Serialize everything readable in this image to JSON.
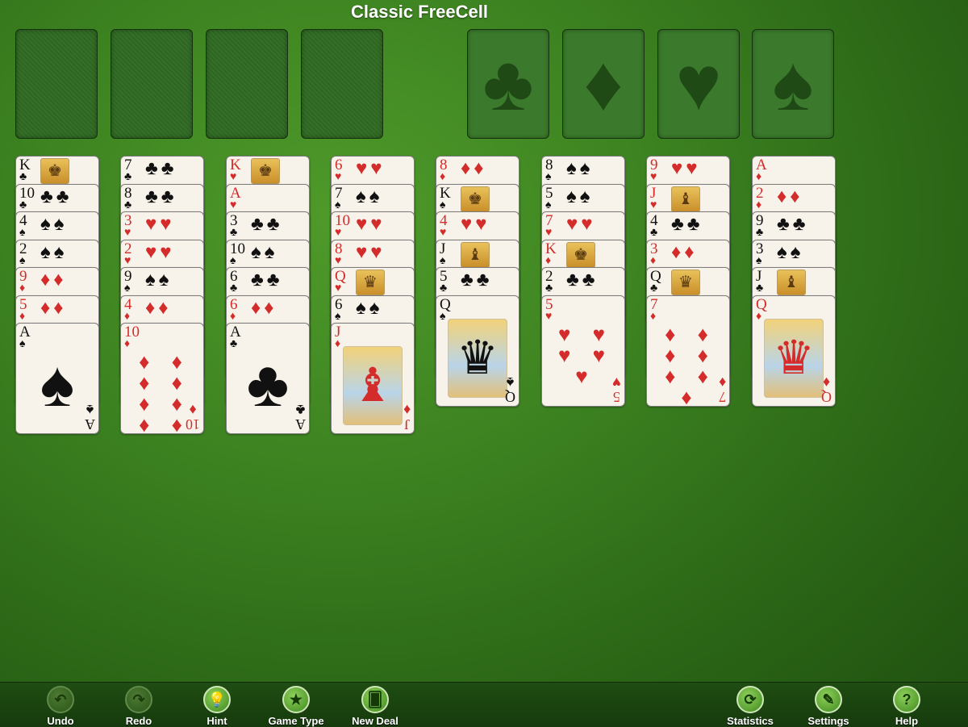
{
  "title": "Classic FreeCell",
  "foundations": [
    {
      "suit": "♣"
    },
    {
      "suit": "♦"
    },
    {
      "suit": "♥"
    },
    {
      "suit": "♠"
    }
  ],
  "columns": [
    [
      {
        "rank": "K",
        "suit": "♣"
      },
      {
        "rank": "10",
        "suit": "♣"
      },
      {
        "rank": "4",
        "suit": "♠"
      },
      {
        "rank": "2",
        "suit": "♠"
      },
      {
        "rank": "9",
        "suit": "♦"
      },
      {
        "rank": "5",
        "suit": "♦"
      },
      {
        "rank": "A",
        "suit": "♠"
      }
    ],
    [
      {
        "rank": "7",
        "suit": "♣"
      },
      {
        "rank": "8",
        "suit": "♣"
      },
      {
        "rank": "3",
        "suit": "♥"
      },
      {
        "rank": "2",
        "suit": "♥"
      },
      {
        "rank": "9",
        "suit": "♠"
      },
      {
        "rank": "4",
        "suit": "♦"
      },
      {
        "rank": "10",
        "suit": "♦"
      }
    ],
    [
      {
        "rank": "K",
        "suit": "♥"
      },
      {
        "rank": "A",
        "suit": "♥"
      },
      {
        "rank": "3",
        "suit": "♣"
      },
      {
        "rank": "10",
        "suit": "♠"
      },
      {
        "rank": "6",
        "suit": "♣"
      },
      {
        "rank": "6",
        "suit": "♦"
      },
      {
        "rank": "A",
        "suit": "♣"
      }
    ],
    [
      {
        "rank": "6",
        "suit": "♥"
      },
      {
        "rank": "7",
        "suit": "♠"
      },
      {
        "rank": "10",
        "suit": "♥"
      },
      {
        "rank": "8",
        "suit": "♥"
      },
      {
        "rank": "Q",
        "suit": "♥"
      },
      {
        "rank": "6",
        "suit": "♠"
      },
      {
        "rank": "J",
        "suit": "♦"
      }
    ],
    [
      {
        "rank": "8",
        "suit": "♦"
      },
      {
        "rank": "K",
        "suit": "♠"
      },
      {
        "rank": "4",
        "suit": "♥"
      },
      {
        "rank": "J",
        "suit": "♠"
      },
      {
        "rank": "5",
        "suit": "♣"
      },
      {
        "rank": "Q",
        "suit": "♠"
      }
    ],
    [
      {
        "rank": "8",
        "suit": "♠"
      },
      {
        "rank": "5",
        "suit": "♠"
      },
      {
        "rank": "7",
        "suit": "♥"
      },
      {
        "rank": "K",
        "suit": "♦"
      },
      {
        "rank": "2",
        "suit": "♣"
      },
      {
        "rank": "5",
        "suit": "♥"
      }
    ],
    [
      {
        "rank": "9",
        "suit": "♥"
      },
      {
        "rank": "J",
        "suit": "♥"
      },
      {
        "rank": "4",
        "suit": "♣"
      },
      {
        "rank": "3",
        "suit": "♦"
      },
      {
        "rank": "Q",
        "suit": "♣"
      },
      {
        "rank": "7",
        "suit": "♦"
      }
    ],
    [
      {
        "rank": "A",
        "suit": "♦"
      },
      {
        "rank": "2",
        "suit": "♦"
      },
      {
        "rank": "9",
        "suit": "♣"
      },
      {
        "rank": "3",
        "suit": "♠"
      },
      {
        "rank": "J",
        "suit": "♣"
      },
      {
        "rank": "Q",
        "suit": "♦"
      }
    ]
  ],
  "toolbar": {
    "left": [
      {
        "label": "Undo",
        "icon": "undo-icon",
        "glyph": "↶",
        "enabled": false
      },
      {
        "label": "Redo",
        "icon": "redo-icon",
        "glyph": "↷",
        "enabled": false
      },
      {
        "label": "Hint",
        "icon": "lightbulb-icon",
        "glyph": "💡",
        "enabled": true
      },
      {
        "label": "Game Type",
        "icon": "star-icon",
        "glyph": "★",
        "enabled": true
      },
      {
        "label": "New Deal",
        "icon": "cards-icon",
        "glyph": "🂠",
        "enabled": true
      }
    ],
    "right": [
      {
        "label": "Statistics",
        "icon": "refresh-stats-icon",
        "glyph": "⟳",
        "enabled": true
      },
      {
        "label": "Settings",
        "icon": "pencil-icon",
        "glyph": "✎",
        "enabled": true
      },
      {
        "label": "Help",
        "icon": "help-icon",
        "glyph": "?",
        "enabled": true
      }
    ]
  },
  "colors": {
    "red": "#d42b2b",
    "black": "#111111",
    "felt": "#3d8321"
  }
}
